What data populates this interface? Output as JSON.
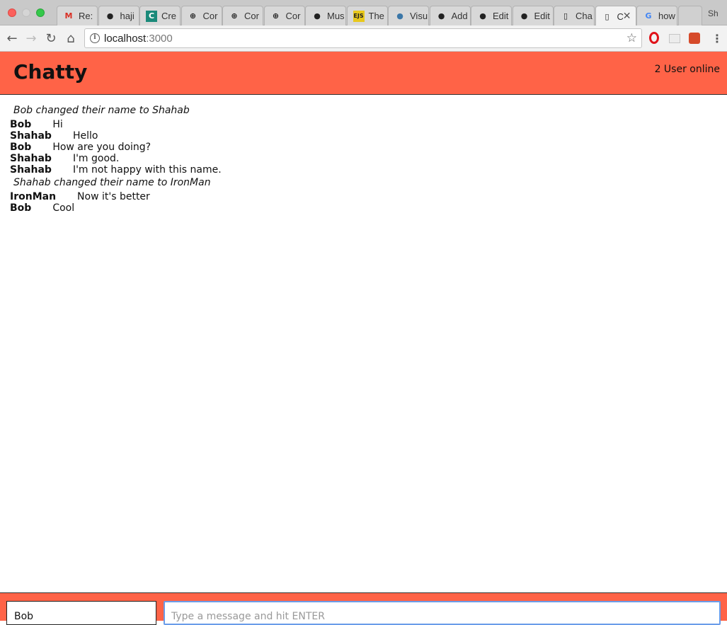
{
  "browser": {
    "tabs": [
      {
        "title": "Re:",
        "icon": "gmail-icon",
        "icon_color": "#d93025",
        "glyph": "M"
      },
      {
        "title": "haji",
        "icon": "github-icon",
        "glyph": "●"
      },
      {
        "title": "Cre",
        "icon": "c-icon",
        "icon_color": "#1a8a7a",
        "glyph": "C"
      },
      {
        "title": "Cor",
        "icon": "plus-circle-icon",
        "glyph": "⊕"
      },
      {
        "title": "Cor",
        "icon": "plus-circle-icon",
        "glyph": "⊕"
      },
      {
        "title": "Cor",
        "icon": "plus-circle-icon",
        "glyph": "⊕"
      },
      {
        "title": "Mus",
        "icon": "github-icon",
        "glyph": "●"
      },
      {
        "title": "The",
        "icon": "ejs-icon",
        "icon_color": "#e8c81b",
        "glyph": "EJS"
      },
      {
        "title": "Visu",
        "icon": "python-icon",
        "icon_color": "#3b77a8",
        "glyph": "●"
      },
      {
        "title": "Add",
        "icon": "github-icon",
        "glyph": "●"
      },
      {
        "title": "Edit",
        "icon": "github-icon",
        "glyph": "●"
      },
      {
        "title": "Edit",
        "icon": "github-icon",
        "glyph": "●"
      },
      {
        "title": "Cha",
        "icon": "page-icon",
        "glyph": "▯"
      },
      {
        "title": "C",
        "icon": "page-icon",
        "glyph": "▯",
        "active": true
      },
      {
        "title": "how",
        "icon": "google-icon",
        "icon_color": "#4285f4",
        "glyph": "G"
      }
    ],
    "profile_label": "Sh",
    "url_host": "localhost",
    "url_port": ":3000"
  },
  "app": {
    "brand": "Chatty",
    "users_online": "2 User online"
  },
  "messages": [
    {
      "type": "system",
      "text": "Bob changed their name to Shahab"
    },
    {
      "type": "message",
      "user": "Bob",
      "text": "Hi"
    },
    {
      "type": "message",
      "user": "Shahab",
      "text": "Hello"
    },
    {
      "type": "message",
      "user": "Bob",
      "text": "How are you doing?"
    },
    {
      "type": "message",
      "user": "Shahab",
      "text": "I'm good."
    },
    {
      "type": "message",
      "user": "Shahab",
      "text": "I'm not happy with this name."
    },
    {
      "type": "system",
      "text": "Shahab changed their name to IronMan"
    },
    {
      "type": "message",
      "user": "IronMan",
      "text": "Now it's better"
    },
    {
      "type": "message",
      "user": "Bob",
      "text": "Cool"
    }
  ],
  "chatbar": {
    "username_value": "Bob",
    "message_placeholder": "Type a message and hit ENTER"
  },
  "colors": {
    "accent": "#ff6347",
    "focus_border": "#6a9ce9"
  }
}
